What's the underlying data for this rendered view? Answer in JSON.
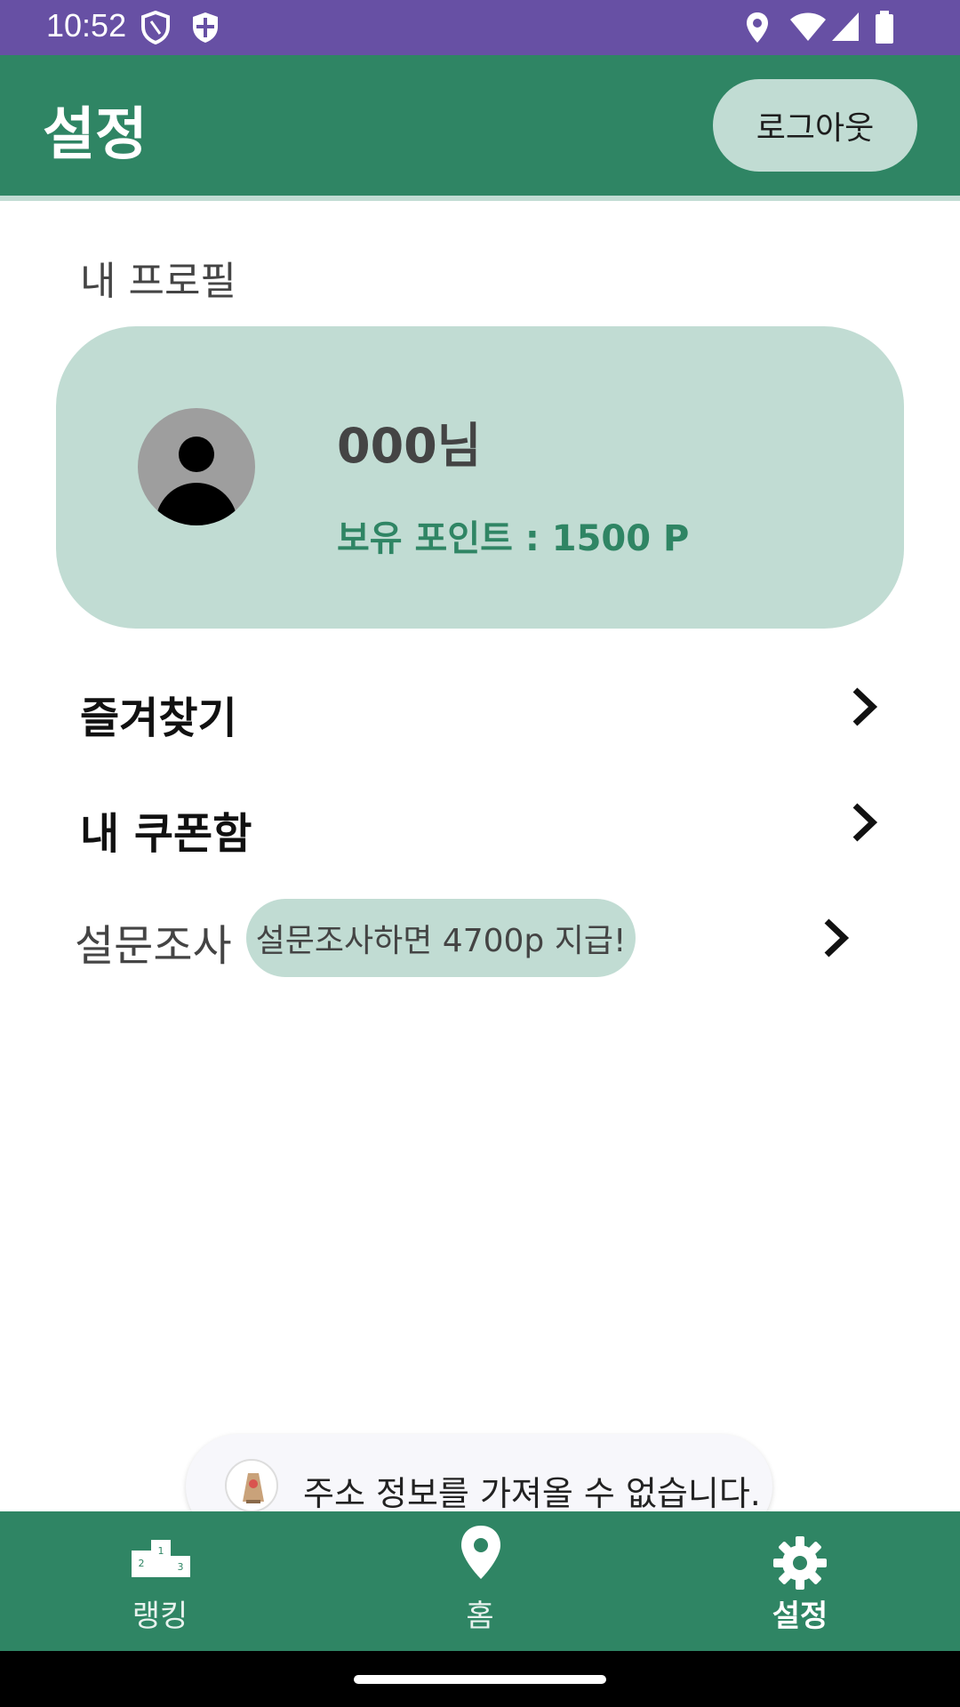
{
  "status_bar": {
    "time": "10:52",
    "icons": [
      "shield-outline-icon",
      "shield-check-icon",
      "location-icon",
      "wifi-icon",
      "signal-icon",
      "battery-icon"
    ],
    "background": "#6750a4"
  },
  "app_bar": {
    "title": "설정",
    "logout_label": "로그아웃",
    "background": "#2f8564"
  },
  "profile": {
    "section_label": "내 프로필",
    "name": "000님",
    "points": "보유 포인트 : 1500 P",
    "card_color": "#c1dcd3",
    "avatar_icon": "person-avatar-icon"
  },
  "menu": {
    "favorites_label": "즐겨찾기",
    "coupons_label": "내 쿠폰함",
    "survey_label": "설문조사",
    "survey_chip": "설문조사하면 4700p 지급!",
    "chevron_icon": "chevron-right-icon"
  },
  "toast": {
    "message": "주소 정보를 가져올 수 없습니다.",
    "icon": "app-icon"
  },
  "bottom_nav": {
    "items": [
      {
        "label": "랭킹",
        "icon": "podium-icon",
        "active": false
      },
      {
        "label": "홈",
        "icon": "location-pin-icon",
        "active": false
      },
      {
        "label": "설정",
        "icon": "gear-icon",
        "active": true
      }
    ]
  },
  "colors": {
    "primary": "#2f8564",
    "light_green": "#c1dcd3",
    "status_purple": "#6750a4"
  }
}
